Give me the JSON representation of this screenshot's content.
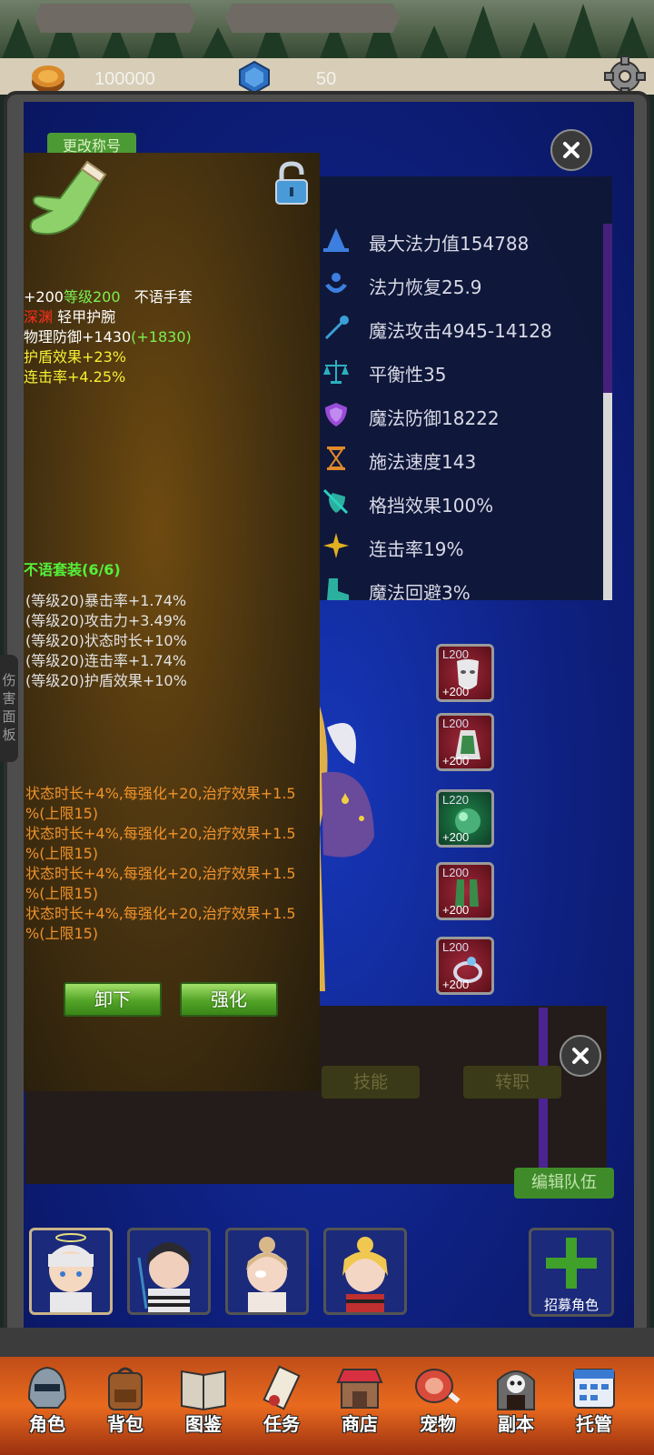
{
  "currency": {
    "gold": "100000",
    "gems": "50"
  },
  "panel": {
    "rename_label": "更改称号",
    "edit_team_label": "编辑队伍"
  },
  "stats": [
    {
      "icon": "wizard-hat-icon",
      "label": "最大法力值154788"
    },
    {
      "icon": "mana-regen-icon",
      "label": "法力恢复25.9"
    },
    {
      "icon": "magic-wand-icon",
      "label": "魔法攻击4945-14128"
    },
    {
      "icon": "balance-scale-icon",
      "label": "平衡性35"
    },
    {
      "icon": "shield-icon",
      "label": "魔法防御18222"
    },
    {
      "icon": "hourglass-icon",
      "label": "施法速度143"
    },
    {
      "icon": "block-icon",
      "label": "格挡效果100%"
    },
    {
      "icon": "star-burst-icon",
      "label": "连击率19%"
    },
    {
      "icon": "boot-icon",
      "label": "魔法回避3%"
    }
  ],
  "equipment": [
    {
      "level": "L200",
      "plus": "+200",
      "icon": "mask-icon"
    },
    {
      "level": "L200",
      "plus": "+200",
      "icon": "cloak-icon"
    },
    {
      "level": "L220",
      "plus": "+200",
      "icon": "orb-icon"
    },
    {
      "level": "L200",
      "plus": "+200",
      "icon": "boots-icon"
    },
    {
      "level": "L200",
      "plus": "+200",
      "icon": "ring-icon"
    }
  ],
  "side_tab": {
    "chars": [
      "伤",
      "害",
      "面",
      "板"
    ]
  },
  "sub_tabs": {
    "skills": "技能",
    "rebirth": "转职"
  },
  "recruit_label": "招募角色",
  "tooltip": {
    "enhance": "+200",
    "level_label": "等级200",
    "item_name": "不语手套",
    "rarity": "深渊",
    "item_type": "轻甲护腕",
    "phys_def": "物理防御+1430",
    "phys_def_bonus": "(+1830)",
    "shield_effect": "护盾效果+23%",
    "combo_rate": "连击率+4.25%",
    "set_name": "不语套装(6/6)",
    "set_bonuses": [
      "(等级20)暴击率+1.74%",
      "(等级20)攻击力+3.49%",
      "(等级20)状态时长+10%",
      "(等级20)连击率+1.74%",
      "(等级20)护盾效果+10%"
    ],
    "special_lines": [
      "状态时长+4%,每强化+20,治疗效果+1.5",
      "%(上限15)",
      "状态时长+4%,每强化+20,治疗效果+1.5",
      "%(上限15)",
      "状态时长+4%,每强化+20,治疗效果+1.5",
      "%(上限15)",
      "状态时长+4%,每强化+20,治疗效果+1.5",
      "%(上限15)"
    ],
    "unequip_label": "卸下",
    "enhance_label": "强化"
  },
  "nav": [
    {
      "icon": "helmet-icon",
      "label": "角色"
    },
    {
      "icon": "backpack-icon",
      "label": "背包"
    },
    {
      "icon": "book-icon",
      "label": "图鉴"
    },
    {
      "icon": "scroll-icon",
      "label": "任务"
    },
    {
      "icon": "shop-icon",
      "label": "商店"
    },
    {
      "icon": "meat-icon",
      "label": "宠物"
    },
    {
      "icon": "skull-gate-icon",
      "label": "副本"
    },
    {
      "icon": "calendar-icon",
      "label": "托管"
    }
  ],
  "colors": {
    "panel_blue": "#0e2080",
    "button_green": "#53a326",
    "nav_orange": "#e96a1e",
    "tooltip_brown": "#4a3410"
  }
}
